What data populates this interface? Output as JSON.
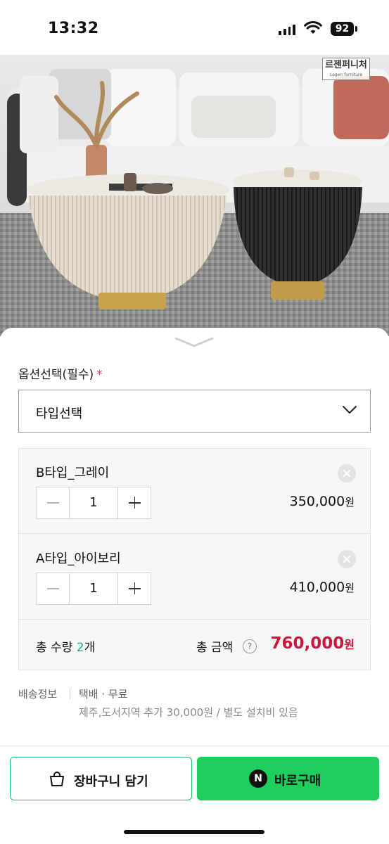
{
  "status_bar": {
    "time": "13:32",
    "battery": "92",
    "icons": [
      "signal-icon",
      "wifi-icon",
      "battery-icon"
    ]
  },
  "hero": {
    "brand_logo_text": "르젠퍼니처",
    "brand_logo_sub": "Legen furniture",
    "image": "product-photo-round-coffee-tables"
  },
  "sheet": {
    "handle_icon": "chevron-down-icon",
    "option_title": "옵션선택(필수)",
    "required_mark": "*",
    "select": {
      "label": "타입선택"
    },
    "items": [
      {
        "name": "B타입_그레이",
        "quantity": "1",
        "price": "350,000",
        "currency": "원"
      },
      {
        "name": "A타입_아이보리",
        "quantity": "1",
        "price": "410,000",
        "currency": "원"
      }
    ],
    "total": {
      "qty_prefix": "총 수량 ",
      "qty_value": "2",
      "qty_suffix": "개",
      "amount_label": "총 금액",
      "help": "?",
      "amount": "760,000",
      "currency": "원"
    },
    "shipping": {
      "label": "배송정보",
      "method": "택배 · 무료",
      "note": "제주,도서지역 추가 30,000원 / 별도 설치비 있음"
    },
    "buttons": {
      "cart_label": "장바구니 담기",
      "buy_label": "바로구매",
      "naver_mark": "N"
    }
  },
  "colors": {
    "accent_green": "#1ecf5e",
    "price_red": "#c8183e",
    "required_red": "#e03a4e",
    "qty_green": "#1fb26a"
  }
}
